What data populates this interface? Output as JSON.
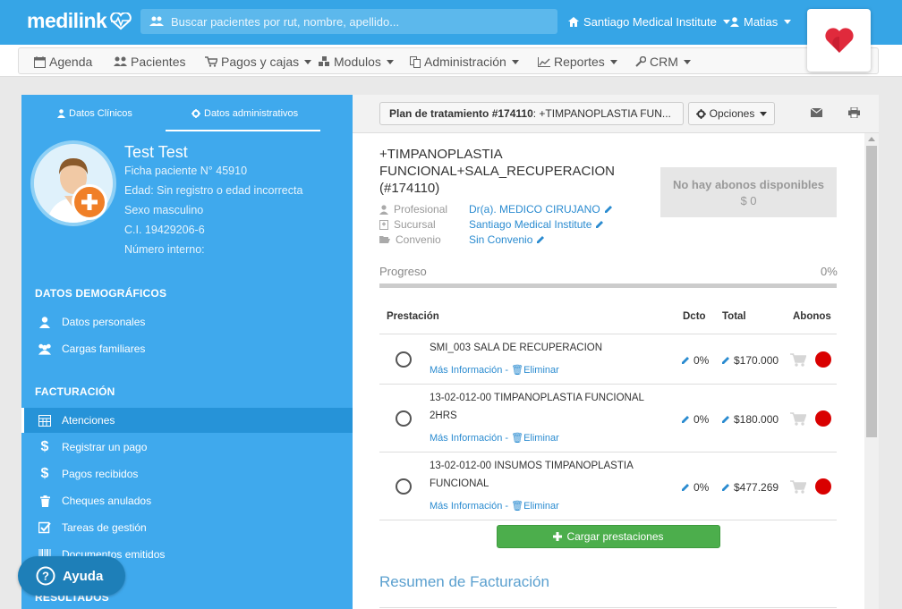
{
  "brand": {
    "name": "medilink"
  },
  "search": {
    "placeholder": "Buscar pacientes por rut, nombre, apellido..."
  },
  "topbar": {
    "clinic": "Santiago Medical Institute",
    "user": "Matias"
  },
  "nav": [
    {
      "label": "Agenda",
      "icon": "calendar-icon"
    },
    {
      "label": "Pacientes",
      "icon": "users-icon"
    },
    {
      "label": "Pagos y cajas",
      "icon": "cart-icon"
    },
    {
      "label": "Modulos",
      "icon": "cubes-icon"
    },
    {
      "label": "Administración",
      "icon": "copy-icon"
    },
    {
      "label": "Reportes",
      "icon": "chart-icon"
    },
    {
      "label": "CRM",
      "icon": "wrench-icon"
    }
  ],
  "sidebar": {
    "tabs": [
      "Datos Clínicos",
      "Datos administrativos"
    ],
    "patient": {
      "name": "Test Test",
      "ficha": "Ficha paciente N° 45910",
      "edad": "Edad: Sin registro o edad incorrecta",
      "sexo": "Sexo masculino",
      "ci": "C.I. 19429206-6",
      "interno": "Número interno:"
    },
    "sections": {
      "demograficos": "DATOS DEMOGRÁFICOS",
      "facturacion": "FACTURACIÓN",
      "resultados": "RESULTADOS"
    },
    "demograficos_items": [
      "Datos personales",
      "Cargas familiares"
    ],
    "facturacion_items": [
      "Atenciones",
      "Registrar un pago",
      "Pagos recibidos",
      "Cheques anulados",
      "Tareas de gestión",
      "Documentos emitidos"
    ],
    "help": "Ayuda"
  },
  "main": {
    "plan_label": "Plan de tratamiento #174110",
    "plan_suffix": ": +TIMPANOPLASTIA FUN...",
    "options": "Opciones",
    "title": "+TIMPANOPLASTIA FUNCIONAL+SALA_RECUPERACION (#174110)",
    "profesional_label": "Profesional",
    "profesional_value": "Dr(a). MEDICO CIRUJANO",
    "sucursal_label": "Sucursal",
    "sucursal_value": "Santiago Medical Institute",
    "convenio_label": "Convenio",
    "convenio_value": "Sin Convenio",
    "abonos_title": "No hay abonos disponibles",
    "abonos_amount": "$ 0",
    "progress_label": "Progreso",
    "progress_value": "0%",
    "progress_fraction": 0,
    "table_headers": {
      "prestacion": "Prestación",
      "dcto": "Dcto",
      "total": "Total",
      "abonos": "Abonos"
    },
    "rows": [
      {
        "name": "SMI_003 SALA DE RECUPERACION",
        "dcto": "0%",
        "total": "$170.000"
      },
      {
        "name": "13-02-012-00 TIMPANOPLASTIA FUNCIONAL 2HRS",
        "dcto": "0%",
        "total": "$180.000"
      },
      {
        "name": "13-02-012-00 INSUMOS TIMPANOPLASTIA FUNCIONAL",
        "dcto": "0%",
        "total": "$477.269"
      }
    ],
    "row_link_more": "Más Información",
    "row_link_sep": " - ",
    "row_link_delete": "Eliminar",
    "cargar": "Cargar prestaciones",
    "resumen": "Resumen de Facturación"
  },
  "colors": {
    "brand_blue": "#36a5e6",
    "sidebar_blue": "#3fa9ed",
    "green": "#4cae4c",
    "red_dot": "#d90000"
  }
}
